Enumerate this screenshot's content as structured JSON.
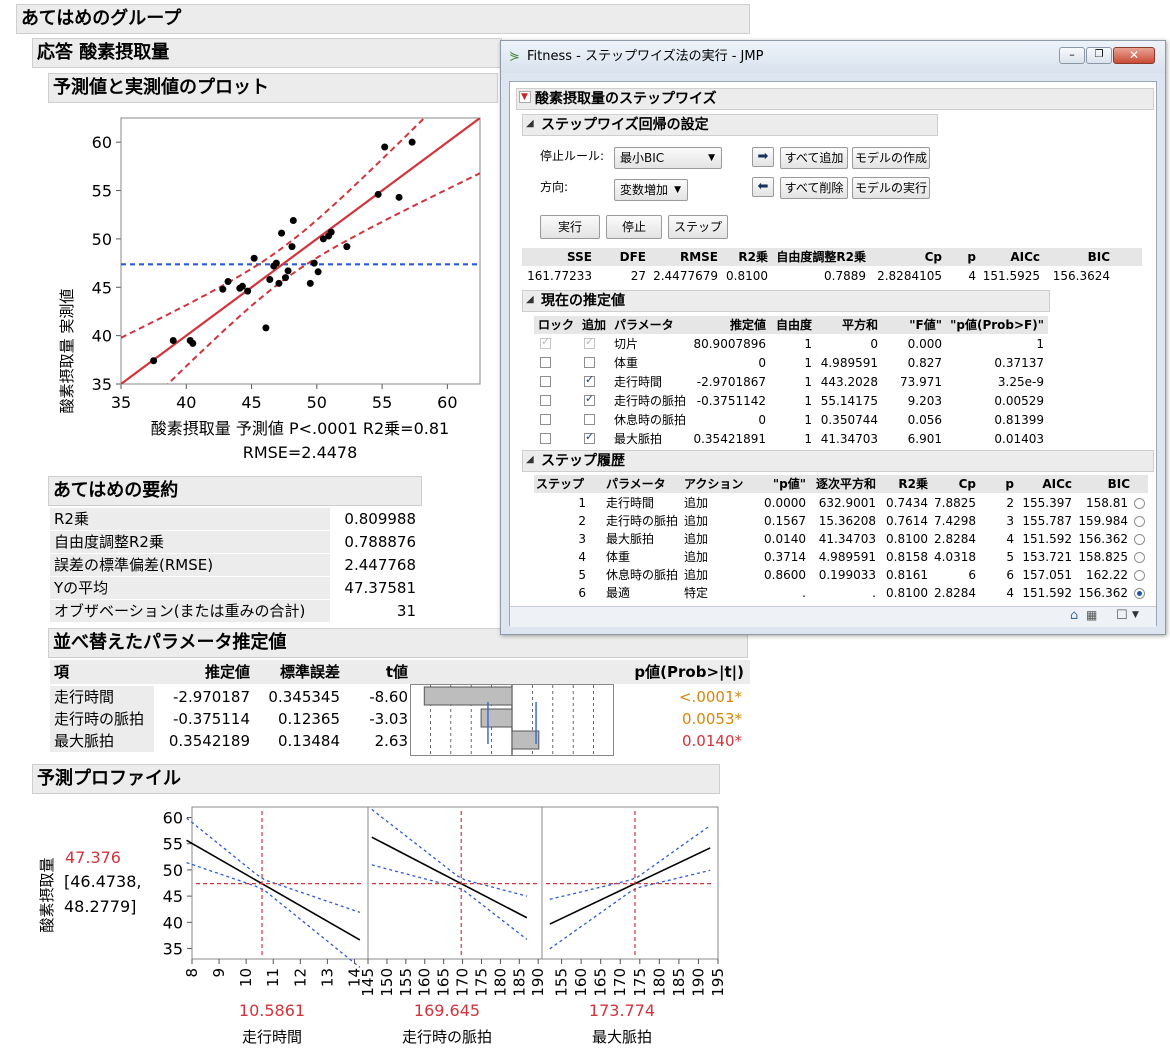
{
  "group_title": "あてはめのグループ",
  "response_header": "応答 酸素摂取量",
  "actual_pred": {
    "title": "予測値と実測値のプロット",
    "ylabel": "酸素摂取量 実測値",
    "xlabel": "酸素摂取量 予測値 P<.0001 R2乗=0.81",
    "rmse_label": "RMSE=2.4478",
    "xticks": [
      "35",
      "40",
      "45",
      "50",
      "55",
      "60"
    ],
    "yticks": [
      "35",
      "40",
      "45",
      "50",
      "55",
      "60"
    ]
  },
  "chart_data": {
    "type": "scatter",
    "title": "予測値と実測値のプロット",
    "xlabel": "酸素摂取量 予測値 P<.0001 R2乗=0.81",
    "ylabel": "酸素摂取量 実測値",
    "xlim": [
      35,
      62.5
    ],
    "ylim": [
      35,
      62.5
    ],
    "mean_line": 47.37581,
    "points": [
      [
        37.5,
        37.4
      ],
      [
        39.0,
        39.5
      ],
      [
        40.3,
        39.5
      ],
      [
        40.5,
        39.2
      ],
      [
        42.8,
        44.8
      ],
      [
        43.2,
        45.6
      ],
      [
        44.1,
        44.9
      ],
      [
        44.3,
        45.1
      ],
      [
        44.7,
        44.6
      ],
      [
        45.2,
        48.0
      ],
      [
        46.1,
        40.8
      ],
      [
        46.4,
        45.8
      ],
      [
        46.7,
        47.2
      ],
      [
        46.9,
        47.5
      ],
      [
        47.1,
        45.4
      ],
      [
        47.3,
        50.6
      ],
      [
        47.6,
        46.0
      ],
      [
        47.8,
        46.7
      ],
      [
        48.1,
        49.2
      ],
      [
        48.2,
        51.9
      ],
      [
        49.5,
        45.4
      ],
      [
        49.8,
        47.5
      ],
      [
        50.1,
        46.6
      ],
      [
        50.5,
        50.0
      ],
      [
        50.9,
        50.3
      ],
      [
        51.1,
        50.7
      ],
      [
        52.3,
        49.2
      ],
      [
        54.7,
        54.6
      ],
      [
        55.2,
        59.5
      ],
      [
        56.3,
        54.3
      ],
      [
        57.3,
        60.0
      ]
    ]
  },
  "summary": {
    "title": "あてはめの要約",
    "rows": [
      {
        "label": "R2乗",
        "value": "0.809988"
      },
      {
        "label": "自由度調整R2乗",
        "value": "0.788876"
      },
      {
        "label": "誤差の標準偏差(RMSE)",
        "value": "2.447768"
      },
      {
        "label": "Yの平均",
        "value": "47.37581"
      },
      {
        "label": "オブザベーション(または重みの合計)",
        "value": "31"
      }
    ]
  },
  "params": {
    "title": "並べ替えたパラメータ推定値",
    "headers": [
      "項",
      "推定値",
      "標準誤差",
      "t値",
      "p値(Prob>|t|)"
    ],
    "rows": [
      {
        "term": "走行時間",
        "est": "-2.970187",
        "se": "0.345345",
        "t": "-8.60",
        "p": "<.0001*",
        "tval": -8.6
      },
      {
        "term": "走行時の脈拍",
        "est": "-0.375114",
        "se": "0.12365",
        "t": "-3.03",
        "p": "0.0053*",
        "tval": -3.03
      },
      {
        "term": "最大脈拍",
        "est": "0.3542189",
        "se": "0.13484",
        "t": "2.63",
        "p": "0.0140*",
        "tval": 2.63
      }
    ],
    "p_colors": [
      "#d4880a",
      "#d4880a",
      "#d1343a"
    ]
  },
  "profiler": {
    "title": "予測プロファイル",
    "ylabel": "酸素摂取量",
    "pred_value": "47.376",
    "ci_line1": "[46.4738,",
    "ci_line2": "48.2779]",
    "yticks": [
      "60",
      "55",
      "50",
      "45",
      "40",
      "35"
    ],
    "panels": [
      {
        "name": "走行時間",
        "current": "10.5861",
        "ticks": [
          "8",
          "9",
          "10",
          "11",
          "12",
          "13",
          "14"
        ]
      },
      {
        "name": "走行時の脈拍",
        "current": "169.645",
        "ticks": [
          "145",
          "150",
          "155",
          "160",
          "165",
          "170",
          "175",
          "180",
          "185",
          "190"
        ]
      },
      {
        "name": "最大脈拍",
        "current": "173.774",
        "ticks": [
          "155",
          "160",
          "165",
          "170",
          "175",
          "180",
          "185",
          "190",
          "195"
        ]
      }
    ],
    "accent": "#d1343a"
  },
  "window": {
    "title": "Fitness - ステップワイズ法の実行 - JMP",
    "stepwise_title": "酸素摂取量のステップワイズ",
    "settings_title": "ステップワイズ回帰の設定",
    "stop_rule_label": "停止ルール:",
    "stop_rule_value": "最小BIC",
    "direction_label": "方向:",
    "direction_value": "変数増加",
    "btn_add_all": "すべて追加",
    "btn_remove_all": "すべて削除",
    "btn_make_model": "モデルの作成",
    "btn_run_model": "モデルの実行",
    "btn_go": "実行",
    "btn_stop": "停止",
    "btn_step": "ステップ",
    "stats_headers": [
      "SSE",
      "DFE",
      "RMSE",
      "R2乗",
      "自由度調整R2乗",
      "Cp",
      "p",
      "AICc",
      "BIC"
    ],
    "stats_values": [
      "161.77233",
      "27",
      "2.4477679",
      "0.8100",
      "0.7889",
      "2.8284105",
      "4",
      "151.5925",
      "156.3624"
    ],
    "current_title": "現在の推定値",
    "current_headers": [
      "ロック",
      "追加",
      "パラメータ",
      "推定値",
      "自由度",
      "平方和",
      "\"F値\"",
      "\"p値(Prob>F)\""
    ],
    "current_rows": [
      {
        "lock": true,
        "enter": true,
        "disabled": true,
        "param": "切片",
        "est": "80.9007896",
        "df": "1",
        "ss": "0",
        "f": "0.000",
        "p": "1"
      },
      {
        "lock": false,
        "enter": false,
        "disabled": false,
        "param": "体重",
        "est": "0",
        "df": "1",
        "ss": "4.989591",
        "f": "0.827",
        "p": "0.37137"
      },
      {
        "lock": false,
        "enter": true,
        "disabled": false,
        "param": "走行時間",
        "est": "-2.9701867",
        "df": "1",
        "ss": "443.2028",
        "f": "73.971",
        "p": "3.25e-9"
      },
      {
        "lock": false,
        "enter": true,
        "disabled": false,
        "param": "走行時の脈拍",
        "est": "-0.3751142",
        "df": "1",
        "ss": "55.14175",
        "f": "9.203",
        "p": "0.00529"
      },
      {
        "lock": false,
        "enter": false,
        "disabled": false,
        "param": "休息時の脈拍",
        "est": "0",
        "df": "1",
        "ss": "0.350744",
        "f": "0.056",
        "p": "0.81399"
      },
      {
        "lock": false,
        "enter": true,
        "disabled": false,
        "param": "最大脈拍",
        "est": "0.35421891",
        "df": "1",
        "ss": "41.34703",
        "f": "6.901",
        "p": "0.01403"
      }
    ],
    "history_title": "ステップ履歴",
    "history_headers": [
      "ステップ",
      "パラメータ",
      "アクション",
      "\"p値\"",
      "逐次平方和",
      "R2乗",
      "Cp",
      "p",
      "AICc",
      "BIC"
    ],
    "history_rows": [
      {
        "step": "1",
        "param": "走行時間",
        "action": "追加",
        "p": "0.0000",
        "ss": "632.9001",
        "r2": "0.7434",
        "cp": "7.8825",
        "np": "2",
        "aicc": "155.397",
        "bic": "158.81",
        "selected": false
      },
      {
        "step": "2",
        "param": "走行時の脈拍",
        "action": "追加",
        "p": "0.1567",
        "ss": "15.36208",
        "r2": "0.7614",
        "cp": "7.4298",
        "np": "3",
        "aicc": "155.787",
        "bic": "159.984",
        "selected": false
      },
      {
        "step": "3",
        "param": "最大脈拍",
        "action": "追加",
        "p": "0.0140",
        "ss": "41.34703",
        "r2": "0.8100",
        "cp": "2.8284",
        "np": "4",
        "aicc": "151.592",
        "bic": "156.362",
        "selected": false
      },
      {
        "step": "4",
        "param": "体重",
        "action": "追加",
        "p": "0.3714",
        "ss": "4.989591",
        "r2": "0.8158",
        "cp": "4.0318",
        "np": "5",
        "aicc": "153.721",
        "bic": "158.825",
        "selected": false
      },
      {
        "step": "5",
        "param": "休息時の脈拍",
        "action": "追加",
        "p": "0.8600",
        "ss": "0.199033",
        "r2": "0.8161",
        "cp": "6",
        "np": "6",
        "aicc": "157.051",
        "bic": "162.22",
        "selected": false
      },
      {
        "step": "6",
        "param": "最適",
        "action": "特定",
        "p": ".",
        "ss": ".",
        "r2": "0.8100",
        "cp": "2.8284",
        "np": "4",
        "aicc": "151.592",
        "bic": "156.362",
        "selected": true
      }
    ]
  }
}
